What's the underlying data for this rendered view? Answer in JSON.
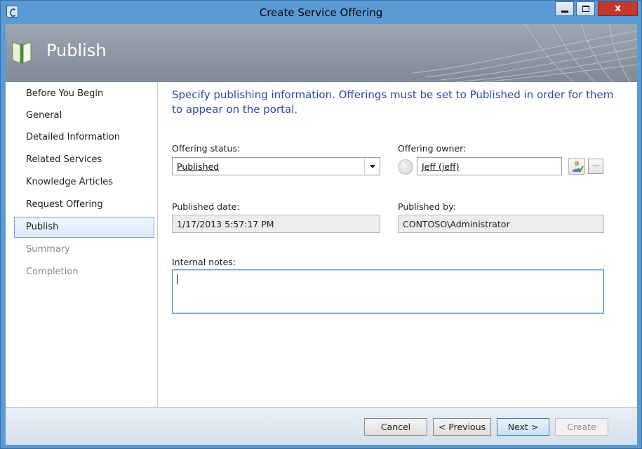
{
  "window": {
    "title": "Create Service Offering",
    "close_glyph": "x"
  },
  "header": {
    "title": "Publish",
    "icon": "book-icon"
  },
  "sidebar": {
    "items": [
      {
        "label": "Before You Begin",
        "state": "normal"
      },
      {
        "label": "General",
        "state": "normal"
      },
      {
        "label": "Detailed Information",
        "state": "normal"
      },
      {
        "label": "Related Services",
        "state": "normal"
      },
      {
        "label": "Knowledge Articles",
        "state": "normal"
      },
      {
        "label": "Request Offering",
        "state": "normal"
      },
      {
        "label": "Publish",
        "state": "active"
      },
      {
        "label": "Summary",
        "state": "disabled"
      },
      {
        "label": "Completion",
        "state": "disabled"
      }
    ]
  },
  "main": {
    "instruction": "Specify publishing information.  Offerings must be set to Published in order for them to appear on the portal.",
    "offering_status": {
      "label": "Offering status:",
      "value": "Published"
    },
    "offering_owner": {
      "label": "Offering owner:",
      "value": "Jeff (jeff)",
      "browse_label": "..."
    },
    "published_date": {
      "label": "Published date:",
      "value": "1/17/2013 5:57:17 PM"
    },
    "published_by": {
      "label": "Published by:",
      "value": "CONTOSO\\Administrator"
    },
    "internal_notes": {
      "label": "Internal notes:",
      "value": ""
    }
  },
  "footer": {
    "cancel_label": "Cancel",
    "previous_label": "< Previous",
    "next_label": "Next >",
    "create_label": "Create"
  },
  "colors": {
    "window_frame": "#5b9bd5",
    "instruction_text": "#2a46a8",
    "close_button": "#c7372d"
  }
}
